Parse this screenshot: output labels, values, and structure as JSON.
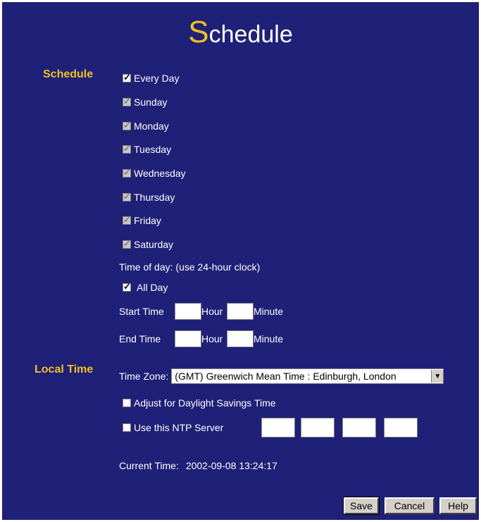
{
  "title": {
    "first_letter": "S",
    "rest": "chedule"
  },
  "schedule": {
    "section_label": "Schedule",
    "every_day": {
      "label": "Every Day",
      "checked": true
    },
    "days": [
      {
        "label": "Sunday",
        "checked": true
      },
      {
        "label": "Monday",
        "checked": true
      },
      {
        "label": "Tuesday",
        "checked": true
      },
      {
        "label": "Wednesday",
        "checked": true
      },
      {
        "label": "Thursday",
        "checked": true
      },
      {
        "label": "Friday",
        "checked": true
      },
      {
        "label": "Saturday",
        "checked": true
      }
    ],
    "time_of_day_label": "Time of day: (use 24-hour clock)",
    "all_day": {
      "label": "All Day",
      "checked": true
    },
    "start_time": {
      "label": "Start Time",
      "hour_label": "Hour",
      "minute_label": "Minute"
    },
    "end_time": {
      "label": "End Time",
      "hour_label": "Hour",
      "minute_label": "Minute"
    }
  },
  "local_time": {
    "section_label": "Local Time",
    "time_zone_label": "Time Zone:",
    "time_zone_value": "(GMT) Greenwich Mean Time : Edinburgh, London",
    "daylight_savings": {
      "label": "Adjust for Daylight Savings Time",
      "checked": false
    },
    "ntp": {
      "label": "Use this NTP Server",
      "checked": false
    },
    "current_time_label": "Current Time:",
    "current_time_value": "2002-09-08 13:24:17"
  },
  "buttons": {
    "save": "Save",
    "cancel": "Cancel",
    "help": "Help"
  },
  "colors": {
    "background": "#1f2077",
    "accent": "#f0c020",
    "text": "#ffffff"
  }
}
